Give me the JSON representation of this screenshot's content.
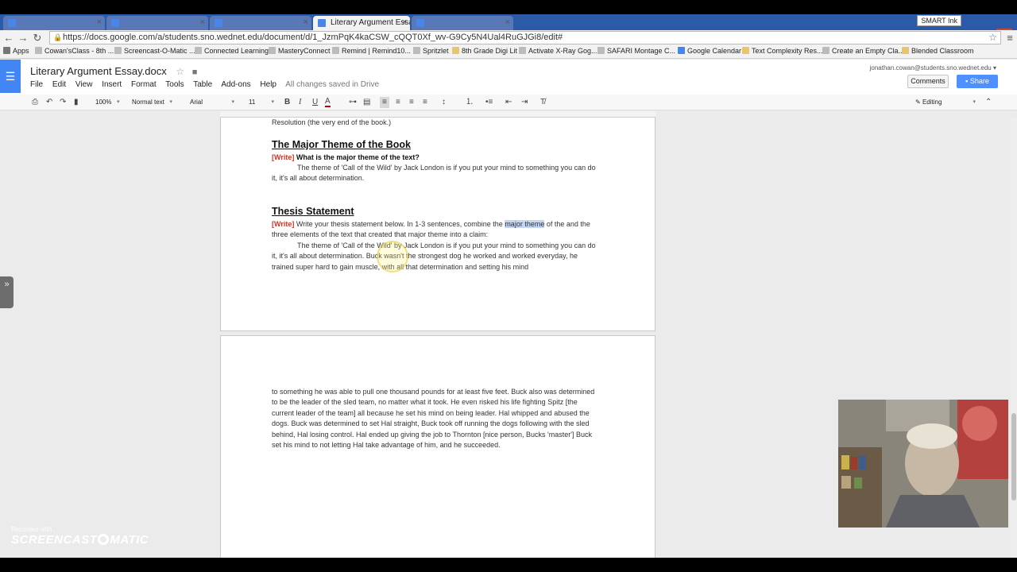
{
  "browser": {
    "tabs": [
      {
        "label": ""
      },
      {
        "label": ""
      },
      {
        "label": ""
      },
      {
        "label": "Literary Argument Essay.d",
        "active": true
      },
      {
        "label": ""
      }
    ],
    "url": "https://docs.google.com/a/students.sno.wednet.edu/document/d/1_JzmPqK4kaCSW_cQQT0Xf_wv-G9Cy5N4Ual4RuGJGi8/edit#",
    "smart_ink_label": "SMART Ink",
    "bookmarks": [
      {
        "label": "Apps",
        "icon": "apps-icon"
      },
      {
        "label": "Cowan'sClass - 8th ...",
        "icon": "page-icon"
      },
      {
        "label": "Screencast-O-Matic ...",
        "icon": "page-icon"
      },
      {
        "label": "Connected Learning",
        "icon": "page-icon"
      },
      {
        "label": "MasteryConnect",
        "icon": "page-icon"
      },
      {
        "label": "Remind | Remind10...",
        "icon": "page-icon"
      },
      {
        "label": "Spritzlet",
        "icon": "page-icon"
      },
      {
        "label": "8th Grade Digi Lit",
        "icon": "folder-icon"
      },
      {
        "label": "Activate X-Ray Gog...",
        "icon": "page-icon"
      },
      {
        "label": "SAFARI Montage C...",
        "icon": "page-icon"
      },
      {
        "label": "Google Calendar",
        "icon": "page-icon"
      },
      {
        "label": "Text Complexity Res...",
        "icon": "folder-icon"
      },
      {
        "label": "Create an Empty Cla...",
        "icon": "page-icon"
      },
      {
        "label": "Blended Classroom",
        "icon": "folder-icon"
      }
    ]
  },
  "doc": {
    "title": "Literary Argument Essay.docx",
    "menus": [
      "File",
      "Edit",
      "View",
      "Insert",
      "Format",
      "Tools",
      "Table",
      "Add-ons",
      "Help"
    ],
    "save_status": "All changes saved in Drive",
    "user_email": "jonathan.cowan@students.sno.wednet.edu",
    "comments_label": "Comments",
    "share_label": "Share"
  },
  "toolbar": {
    "zoom": "100%",
    "style": "Normal text",
    "font": "Arial",
    "size": "11",
    "mode": "Editing",
    "text_color": "#c00000"
  },
  "page1": {
    "resolution_line": "Resolution (the very end of the book.)",
    "theme_heading": "The Major Theme of the Book",
    "theme_prompt_tag": "[Write]",
    "theme_prompt": " What is the major theme of the text?",
    "theme_answer": "The theme of 'Call of the Wild' by Jack London is if you put your mind to something you can do it, it's all about determination.",
    "thesis_heading": "Thesis Statement",
    "thesis_prompt_tag": "[Write]",
    "thesis_prompt_before": "  Write your thesis statement below. In 1-3 sentences, combine the ",
    "thesis_prompt_highlight": "major theme",
    "thesis_prompt_after": " of the and the three elements of the text that created that major theme into a claim:",
    "thesis_answer": "The theme of 'Call of the Wild' by Jack London is if you put your mind to something you can do it, it's all about determination. Buck wasn't the strongest dog he worked and worked everyday, he trained super hard to gain muscle, with all that determination and setting his mind"
  },
  "page2": {
    "continued_text": "to something he was able to pull one thousand pounds for at least five feet. Buck also was determined to be the leader of the sled team, no matter what it took. He even risked his life fighting Spitz [the current leader of the team] all because he set his mind on being leader. Hal whipped and abused the dogs. Buck was determined to set Hal straight, Buck took off running the dogs following with the sled behind, Hal losing control. Hal ended up giving the job to Thornton [nice person, Bucks 'master'] Buck set his mind to not letting Hal take advantage of him, and he succeeded."
  },
  "watermark": {
    "line1": "Recorded with",
    "line2": "SCREENCAST",
    "line3": "MATIC"
  },
  "colors": {
    "accent": "#4285f4",
    "share": "#4d90fe",
    "write_tag": "#c0392b",
    "highlight": "#c3d6f5",
    "tabstrip": "#2b5aa9"
  }
}
